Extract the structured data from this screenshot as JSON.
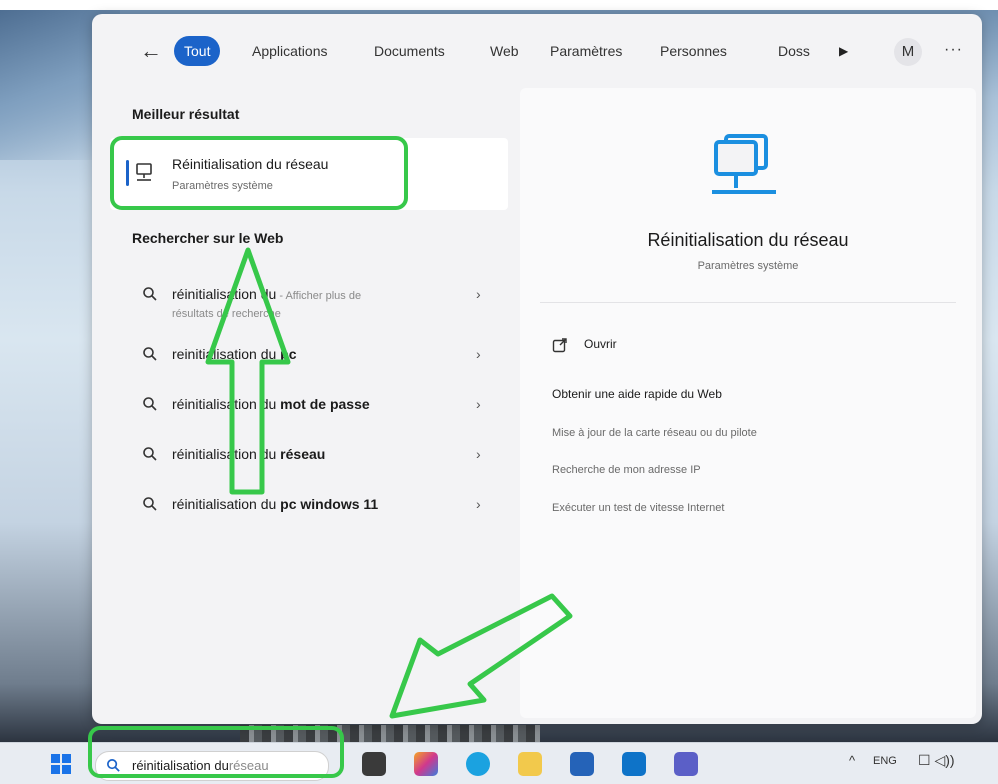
{
  "filters": {
    "back_label": "←",
    "tabs": [
      "Tout",
      "Applications",
      "Documents",
      "Web",
      "Paramètres",
      "Personnes",
      "Doss"
    ],
    "play": "▶",
    "avatar": "M",
    "more": "···"
  },
  "best_match": {
    "section": "Meilleur résultat",
    "title": "Réinitialisation du réseau",
    "subtitle": "Paramètres système"
  },
  "web_search": {
    "section": "Rechercher sur le Web",
    "items": [
      {
        "prefix": "réinitialisation du",
        "bold": "",
        "suffix": " - Afficher plus de",
        "line2": "résultats de recherche"
      },
      {
        "prefix": "reinitialisation du ",
        "bold": "pc",
        "suffix": "",
        "line2": ""
      },
      {
        "prefix": "réinitialisation du ",
        "bold": "mot de passe",
        "suffix": "",
        "line2": ""
      },
      {
        "prefix": "réinitialisation du ",
        "bold": "réseau",
        "suffix": "",
        "line2": ""
      },
      {
        "prefix": "réinitialisation du ",
        "bold": "pc windows 11",
        "suffix": "",
        "line2": ""
      }
    ]
  },
  "preview": {
    "title": "Réinitialisation du réseau",
    "subtitle": "Paramètres système",
    "open": "Ouvrir",
    "help_title": "Obtenir une aide rapide du Web",
    "links": [
      "Mise à jour de la carte réseau ou du pilote",
      "Recherche de mon adresse IP",
      "Exécuter un test de vitesse Internet"
    ]
  },
  "taskbar": {
    "search_query": "réinitialisation du",
    "search_placeholder": "réseau",
    "lang": "ENG",
    "tray_icons": "☐ ◁))",
    "chevron": "^"
  },
  "colors": {
    "accent": "#1b63c9",
    "highlight_green": "#37c84a",
    "panel_bg": "#f3f3f5"
  }
}
